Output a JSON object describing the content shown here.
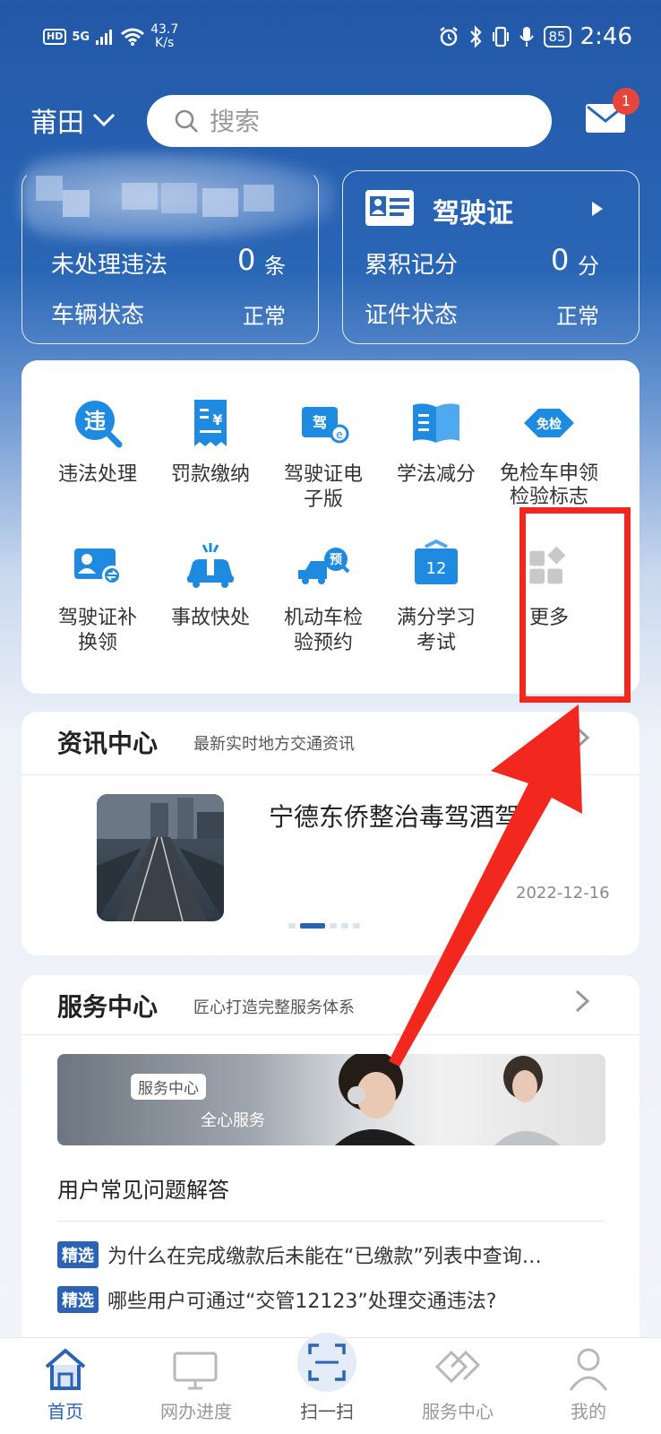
{
  "status_bar": {
    "network": "HD",
    "signal": "5G",
    "speed_value": "43.7",
    "speed_unit": "K/s",
    "battery": "85",
    "time": "2:46"
  },
  "header": {
    "city": "莆田",
    "search_placeholder": "搜索",
    "mail_badge": "1"
  },
  "vehicle_card": {
    "violations_label": "未处理违法",
    "violations_count": "0",
    "violations_unit": "条",
    "status_label": "车辆状态",
    "status_value": "正常"
  },
  "license_card": {
    "title": "驾驶证",
    "points_label": "累积记分",
    "points_value": "0",
    "points_unit": "分",
    "status_label": "证件状态",
    "status_value": "正常"
  },
  "services": [
    {
      "label": "违法处理",
      "icon_char": "违"
    },
    {
      "label": "罚款缴纳",
      "icon_char": "¥"
    },
    {
      "label": "驾驶证电子版",
      "icon_char": "驾"
    },
    {
      "label": "学法减分",
      "icon_char": ""
    },
    {
      "label": "免检车申领检验标志",
      "icon_char": "免检"
    },
    {
      "label": "驾驶证补换领",
      "icon_char": ""
    },
    {
      "label": "事故快处",
      "icon_char": ""
    },
    {
      "label": "机动车检验预约",
      "icon_char": "预"
    },
    {
      "label": "满分学习考试",
      "icon_char": "12"
    },
    {
      "label": "更多",
      "icon_char": ""
    }
  ],
  "news": {
    "title": "资讯中心",
    "subtitle": "最新实时地方交通资讯",
    "headline": "宁德东侨整治毒驾酒驾",
    "date": "2022-12-16"
  },
  "service_center": {
    "title": "服务中心",
    "subtitle": "匠心打造完整服务体系",
    "banner_tag": "服务中心",
    "banner_slogan": "全心服务",
    "faq_title": "用户常见问题解答",
    "faq_items": [
      {
        "tag": "精选",
        "text": "为什么在完成缴款后未能在“已缴款”列表中查询…"
      },
      {
        "tag": "精选",
        "text": "哪些用户可通过“交管12123”处理交通违法?"
      }
    ]
  },
  "bottom_nav": [
    {
      "label": "首页",
      "active": true
    },
    {
      "label": "网办进度",
      "active": false
    },
    {
      "label": "扫一扫",
      "active": false
    },
    {
      "label": "服务中心",
      "active": false
    },
    {
      "label": "我的",
      "active": false
    }
  ],
  "colors": {
    "primary": "#2c63b4",
    "accent_red": "#f2281f",
    "icon_blue": "#1e8be0"
  }
}
